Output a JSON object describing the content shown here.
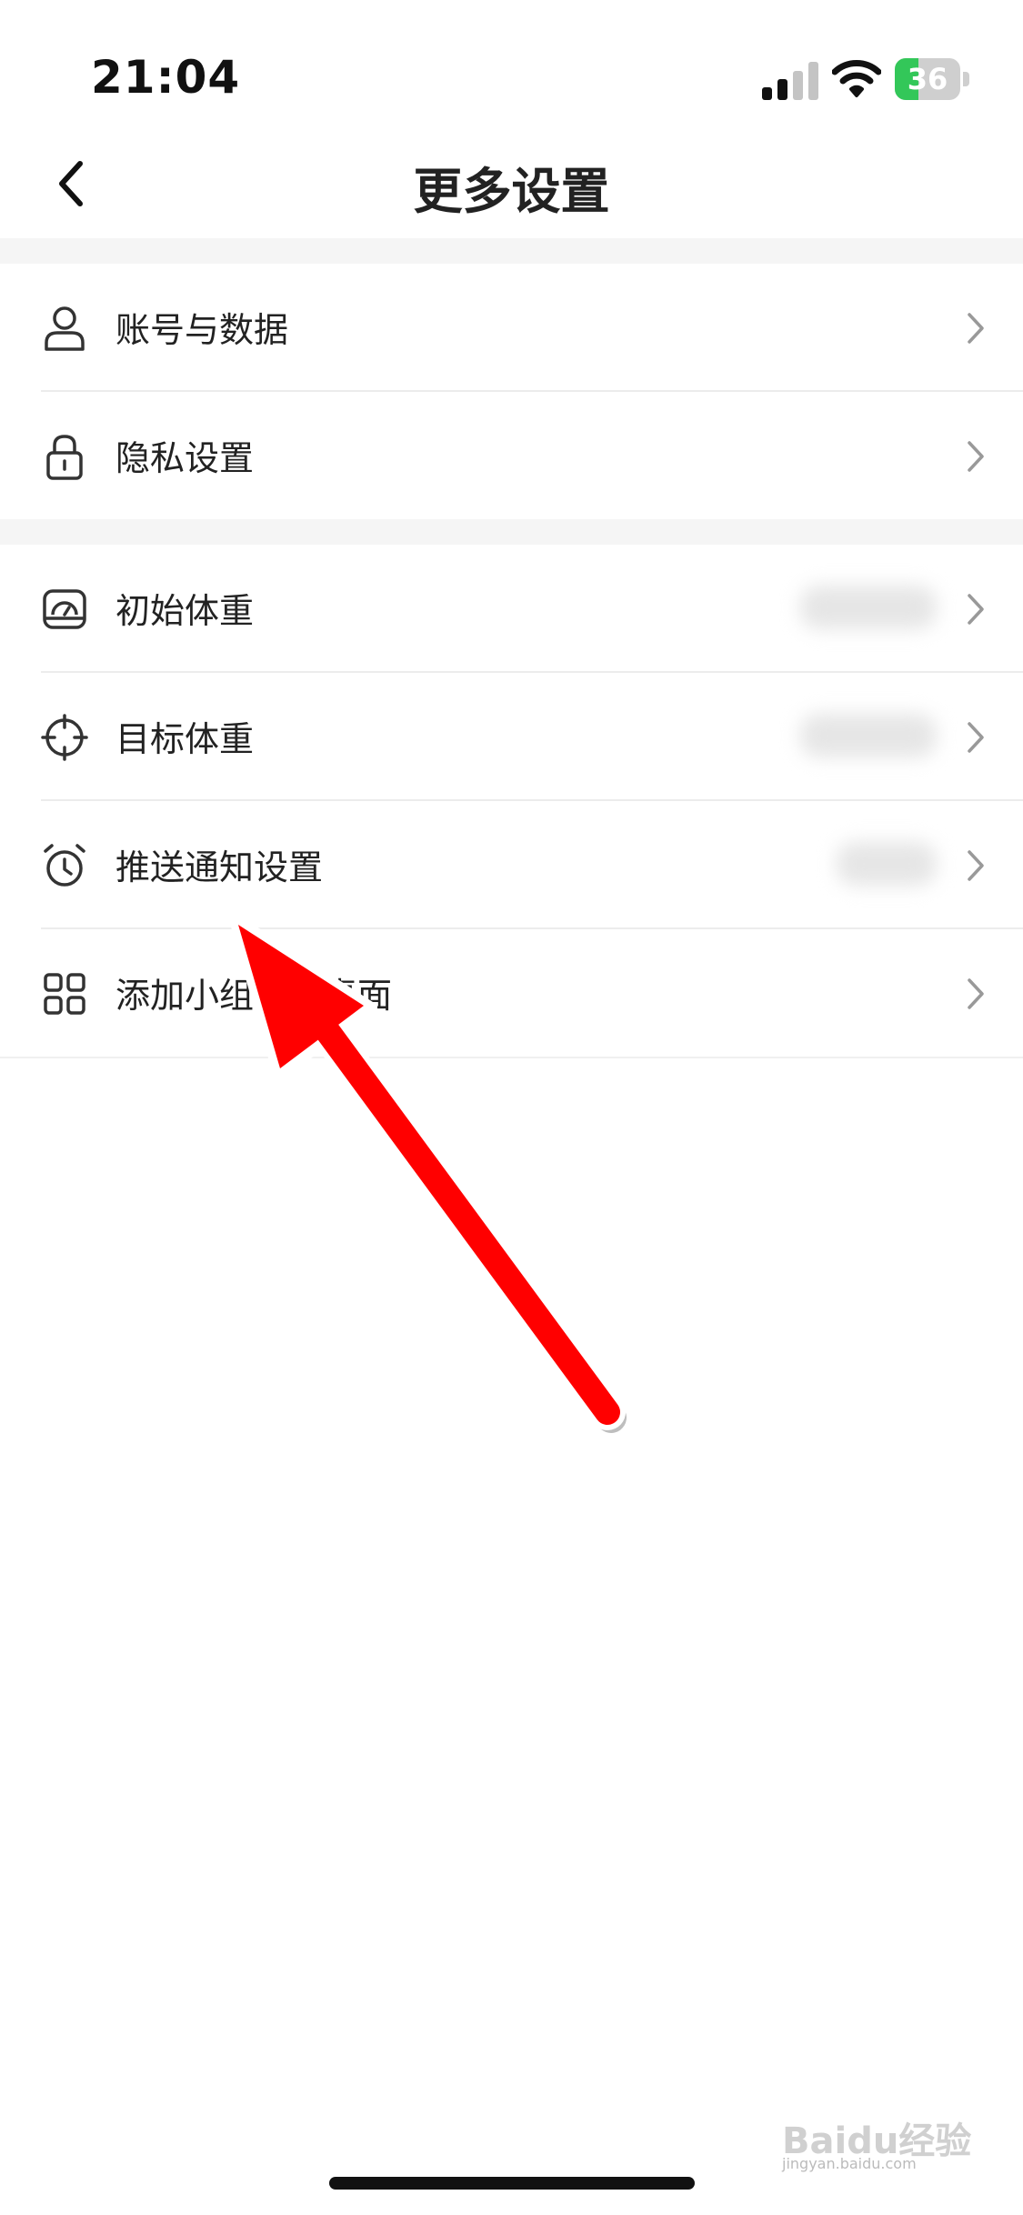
{
  "status_bar": {
    "time": "21:04",
    "battery_percent": 36,
    "battery_text": "36",
    "charging": true
  },
  "header": {
    "title": "更多设置",
    "back_icon": "chevron-left-icon"
  },
  "settings": {
    "group1": [
      {
        "label": "账号与数据",
        "icon": "user-icon"
      },
      {
        "label": "隐私设置",
        "icon": "lock-icon"
      }
    ],
    "group2": [
      {
        "label": "初始体重",
        "icon": "scale-icon",
        "value_blurred": true
      },
      {
        "label": "目标体重",
        "icon": "target-icon",
        "value_blurred": true
      },
      {
        "label": "推送通知设置",
        "icon": "alarm-clock-icon",
        "value_blurred": true
      },
      {
        "label": "添加小组件到桌面",
        "icon": "grid-icon",
        "value_blurred": false
      }
    ]
  },
  "colors": {
    "background": "#ffffff",
    "section_gap": "#f5f5f5",
    "battery_green": "#33c759",
    "annotation_red": "#ff0000"
  },
  "overlay": {
    "annotation": "red-arrow-icon",
    "watermark_text": "Baidu经验",
    "watermark_subtext": "jingyan.baidu.com"
  }
}
